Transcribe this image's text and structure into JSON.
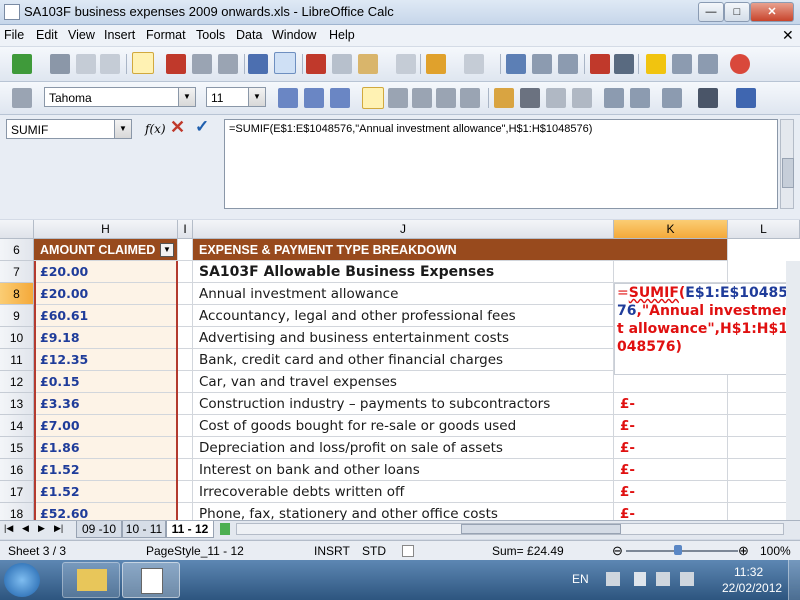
{
  "window": {
    "title": "SA103F business expenses 2009 onwards.xls - LibreOffice Calc"
  },
  "menu": [
    "File",
    "Edit",
    "View",
    "Insert",
    "Format",
    "Tools",
    "Data",
    "Window",
    "Help"
  ],
  "format_toolbar": {
    "font_name": "Tahoma",
    "font_size": "11"
  },
  "formula_bar": {
    "name_box": "SUMIF",
    "fx_label": "f(x)",
    "formula": "=SUMIF(E$1:E$1048576,\"Annual investment allowance\",H$1:H$1048576)"
  },
  "sheet": {
    "columns": [
      "H",
      "I",
      "J",
      "K",
      "L"
    ],
    "header_row": {
      "row": "6",
      "H": "AMOUNT CLAIMED",
      "J": "EXPENSE & PAYMENT TYPE BREAKDOWN"
    },
    "rows": [
      {
        "row": "7",
        "H": "£20.00",
        "J": "SA103F Allowable Business Expenses",
        "K": ""
      },
      {
        "row": "8",
        "H": "£20.00",
        "J": "Annual investment allowance",
        "K": ""
      },
      {
        "row": "9",
        "H": "£60.61",
        "J": "Accountancy, legal and other professional fees",
        "K": ""
      },
      {
        "row": "10",
        "H": "£9.18",
        "J": "Advertising and business entertainment costs",
        "K": ""
      },
      {
        "row": "11",
        "H": "£12.35",
        "J": "Bank, credit card and other financial charges",
        "K": ""
      },
      {
        "row": "12",
        "H": "£0.15",
        "J": "Car, van and travel expenses",
        "K": ""
      },
      {
        "row": "13",
        "H": "£3.36",
        "J": "Construction industry – payments to subcontractors",
        "K": "£-"
      },
      {
        "row": "14",
        "H": "£7.00",
        "J": "Cost of goods bought for re-sale or goods used",
        "K": "£-"
      },
      {
        "row": "15",
        "H": "£1.86",
        "J": "Depreciation and loss/profit on sale of assets",
        "K": "£-"
      },
      {
        "row": "16",
        "H": "£1.52",
        "J": "Interest on bank and other loans",
        "K": "£-"
      },
      {
        "row": "17",
        "H": "£1.52",
        "J": "Irrecoverable debts written off",
        "K": "£-"
      },
      {
        "row": "18",
        "H": "£52.60",
        "J": "Phone, fax, stationery and other office costs",
        "K": "£-"
      }
    ],
    "edit_cell": {
      "eq": "=",
      "func": "SUMIF",
      "p1": "(",
      "ref1": "E$1:E$1048576",
      "comma1": ",",
      "criteria": "\"Annual investment allowance\"",
      "comma2": ",",
      "ref2": "H$1:H$1048576",
      "p2": ")"
    }
  },
  "tabs": [
    "09 -10",
    "10 - 11",
    "11 - 12"
  ],
  "status": {
    "sheet": "Sheet 3 / 3",
    "page_style": "PageStyle_11 - 12",
    "insert": "INSRT",
    "std": "STD",
    "sum": "Sum= £24.49",
    "zoom": "100%"
  },
  "taskbar": {
    "lang": "EN",
    "time": "11:32",
    "date": "22/02/2012"
  },
  "colors": {
    "header_fill": "#984a1d",
    "amount_text": "#1f3c9a",
    "formula_red": "#e01010",
    "selected_header": "#f7b84f"
  }
}
